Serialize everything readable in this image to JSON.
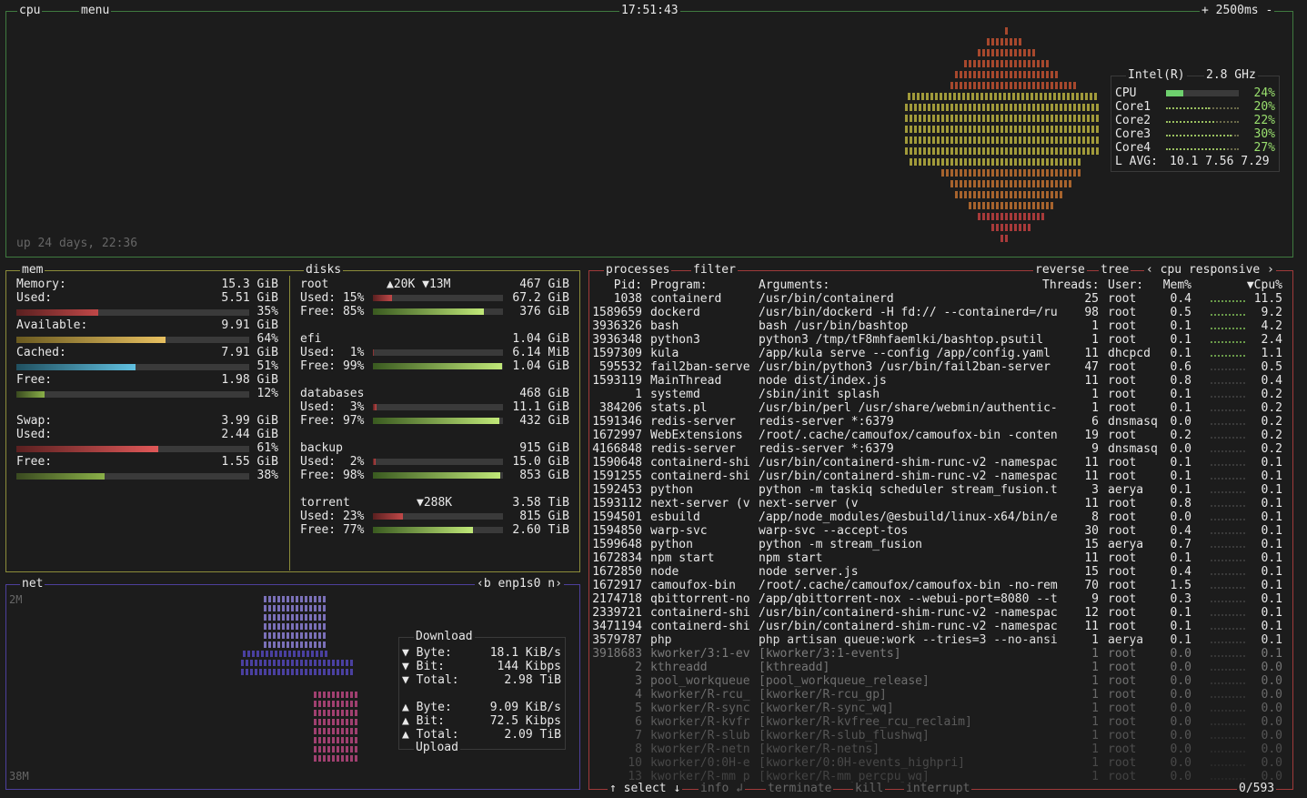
{
  "cpu": {
    "title": "cpu",
    "menu": "menu",
    "clock": "17:51:43",
    "interval": "+ 2500ms -",
    "uptime": "up 24 days, 22:36",
    "model": "Intel(R)",
    "freq": "2.8 GHz",
    "rows": [
      {
        "name": "CPU",
        "pct": "24%",
        "value": 0.24
      },
      {
        "name": "Core1",
        "pct": "20%",
        "value": 0.2
      },
      {
        "name": "Core2",
        "pct": "22%",
        "value": 0.22
      },
      {
        "name": "Core3",
        "pct": "30%",
        "value": 0.3
      },
      {
        "name": "Core4",
        "pct": "27%",
        "value": 0.27
      }
    ],
    "load_label": "L AVG:",
    "load": "10.1 7.56 7.29"
  },
  "mem": {
    "title": "mem",
    "memory_label": "Memory:",
    "memory_total": "15.3 GiB",
    "used_label": "Used:",
    "used_val": "5.51 GiB",
    "used_pct": "35%",
    "used_frac": 0.35,
    "avail_label": "Available:",
    "avail_val": "9.91 GiB",
    "avail_pct": "64%",
    "avail_frac": 0.64,
    "cached_label": "Cached:",
    "cached_val": "7.91 GiB",
    "cached_pct": "51%",
    "cached_frac": 0.51,
    "free_label": "Free:",
    "free_val": "1.98 GiB",
    "free_pct": "12%",
    "free_frac": 0.12,
    "swap_label": "Swap:",
    "swap_total": "3.99 GiB",
    "swap_used_label": "Used:",
    "swap_used_val": "2.44 GiB",
    "swap_used_pct": "61%",
    "swap_used_frac": 0.61,
    "swap_free_label": "Free:",
    "swap_free_val": "1.55 GiB",
    "swap_free_pct": "38%",
    "swap_free_frac": 0.38
  },
  "disks": {
    "title": "disks",
    "list": [
      {
        "name": "root",
        "io": "▲20K ▼13M",
        "total": "467 GiB",
        "used_label": "Used: 15%",
        "used": "67.2 GiB",
        "free_label": "Free: 85%",
        "free": "376 GiB",
        "used_frac": 0.15,
        "free_frac": 0.85
      },
      {
        "name": "efi",
        "io": "",
        "total": "1.04 GiB",
        "used_label": "Used:  1%",
        "used": "6.14 MiB",
        "free_label": "Free: 99%",
        "free": "1.04 GiB",
        "used_frac": 0.01,
        "free_frac": 0.99
      },
      {
        "name": "databases",
        "io": "",
        "total": "468 GiB",
        "used_label": "Used:  3%",
        "used": "11.1 GiB",
        "free_label": "Free: 97%",
        "free": "432 GiB",
        "used_frac": 0.03,
        "free_frac": 0.97
      },
      {
        "name": "backup",
        "io": "",
        "total": "915 GiB",
        "used_label": "Used:  2%",
        "used": "15.0 GiB",
        "free_label": "Free: 98%",
        "free": "853 GiB",
        "used_frac": 0.02,
        "free_frac": 0.98
      },
      {
        "name": "torrent",
        "io": "▼288K",
        "total": "3.58 TiB",
        "used_label": "Used: 23%",
        "used": "815 GiB",
        "free_label": "Free: 77%",
        "free": "2.60 TiB",
        "used_frac": 0.23,
        "free_frac": 0.77
      }
    ]
  },
  "net": {
    "title": "net",
    "iface": "‹b enp1s0 n›",
    "scale_top": "2M",
    "scale_bottom": "38M",
    "download_label": "Download",
    "upload_label": "Upload",
    "down": [
      {
        "label": "▼ Byte:",
        "value": "18.1 KiB/s"
      },
      {
        "label": "▼ Bit:",
        "value": "144 Kibps"
      },
      {
        "label": "▼ Total:",
        "value": "2.98 TiB"
      }
    ],
    "up": [
      {
        "label": "▲ Byte:",
        "value": "9.09 KiB/s"
      },
      {
        "label": "▲ Bit:",
        "value": "72.5 Kibps"
      },
      {
        "label": "▲ Total:",
        "value": "2.09 TiB"
      }
    ]
  },
  "proc": {
    "title": "processes",
    "filter": "filter",
    "reverse": "reverse",
    "tree": "tree",
    "sort": "‹ cpu responsive ›",
    "headers": {
      "pid": "Pid:",
      "program": "Program:",
      "args": "Arguments:",
      "threads": "Threads:",
      "user": "User:",
      "mem": "Mem%",
      "cpu": "▼Cpu%"
    },
    "rows": [
      [
        "1038",
        "containerd",
        "/usr/bin/containerd",
        "25",
        "root",
        "0.4",
        "11.5"
      ],
      [
        "1589659",
        "dockerd",
        "/usr/bin/dockerd -H fd:// --containerd=/ru",
        "98",
        "root",
        "0.5",
        "9.2"
      ],
      [
        "3936326",
        "bash",
        "bash /usr/bin/bashtop",
        "1",
        "root",
        "0.1",
        "4.2"
      ],
      [
        "3936348",
        "python3",
        "python3 /tmp/tF8mhfaemlki/bashtop.psutil",
        "1",
        "root",
        "0.1",
        "2.4"
      ],
      [
        "1597309",
        "kula",
        "/app/kula serve --config /app/config.yaml",
        "11",
        "dhcpcd",
        "0.1",
        "1.1"
      ],
      [
        "595532",
        "fail2ban-serve",
        "/usr/bin/python3 /usr/bin/fail2ban-server",
        "47",
        "root",
        "0.6",
        "0.5"
      ],
      [
        "1593119",
        "MainThread",
        "node dist/index.js",
        "11",
        "root",
        "0.8",
        "0.4"
      ],
      [
        "1",
        "systemd",
        "/sbin/init splash",
        "1",
        "root",
        "0.1",
        "0.2"
      ],
      [
        "384206",
        "stats.pl",
        "/usr/bin/perl /usr/share/webmin/authentic-",
        "1",
        "root",
        "0.1",
        "0.2"
      ],
      [
        "1591346",
        "redis-server",
        "redis-server *:6379",
        "6",
        "dnsmasq",
        "0.0",
        "0.2"
      ],
      [
        "1672997",
        "WebExtensions",
        "/root/.cache/camoufox/camoufox-bin -conten",
        "19",
        "root",
        "0.2",
        "0.2"
      ],
      [
        "4166848",
        "redis-server",
        "redis-server *:6379",
        "9",
        "dnsmasq",
        "0.0",
        "0.2"
      ],
      [
        "1590648",
        "containerd-shi",
        "/usr/bin/containerd-shim-runc-v2 -namespac",
        "11",
        "root",
        "0.1",
        "0.1"
      ],
      [
        "1591255",
        "containerd-shi",
        "/usr/bin/containerd-shim-runc-v2 -namespac",
        "11",
        "root",
        "0.1",
        "0.1"
      ],
      [
        "1592453",
        "python",
        "python -m taskiq scheduler stream_fusion.t",
        "3",
        "aerya",
        "0.1",
        "0.1"
      ],
      [
        "1593112",
        "next-server (v",
        "next-server (v",
        "11",
        "root",
        "0.8",
        "0.1"
      ],
      [
        "1594501",
        "esbuild",
        "/app/node_modules/@esbuild/linux-x64/bin/e",
        "8",
        "root",
        "0.0",
        "0.1"
      ],
      [
        "1594850",
        "warp-svc",
        "warp-svc --accept-tos",
        "30",
        "root",
        "0.4",
        "0.1"
      ],
      [
        "1599648",
        "python",
        "python -m stream_fusion",
        "15",
        "aerya",
        "0.7",
        "0.1"
      ],
      [
        "1672834",
        "npm start",
        "npm start",
        "11",
        "root",
        "0.1",
        "0.1"
      ],
      [
        "1672850",
        "node",
        "node server.js",
        "15",
        "root",
        "0.4",
        "0.1"
      ],
      [
        "1672917",
        "camoufox-bin",
        "/root/.cache/camoufox/camoufox-bin -no-rem",
        "70",
        "root",
        "1.5",
        "0.1"
      ],
      [
        "2174718",
        "qbittorrent-no",
        "/app/qbittorrent-nox --webui-port=8080 --t",
        "9",
        "root",
        "0.3",
        "0.1"
      ],
      [
        "2339721",
        "containerd-shi",
        "/usr/bin/containerd-shim-runc-v2 -namespac",
        "12",
        "root",
        "0.1",
        "0.1"
      ],
      [
        "3471194",
        "containerd-shi",
        "/usr/bin/containerd-shim-runc-v2 -namespac",
        "11",
        "root",
        "0.1",
        "0.1"
      ],
      [
        "3579787",
        "php",
        "php artisan queue:work --tries=3 --no-ansi",
        "1",
        "aerya",
        "0.1",
        "0.1"
      ],
      [
        "3918683",
        "kworker/3:1-ev",
        "[kworker/3:1-events]",
        "1",
        "root",
        "0.0",
        "0.1"
      ],
      [
        "2",
        "kthreadd",
        "[kthreadd]",
        "1",
        "root",
        "0.0",
        "0.0"
      ],
      [
        "3",
        "pool_workqueue",
        "[pool_workqueue_release]",
        "1",
        "root",
        "0.0",
        "0.0"
      ],
      [
        "4",
        "kworker/R-rcu_",
        "[kworker/R-rcu_gp]",
        "1",
        "root",
        "0.0",
        "0.0"
      ],
      [
        "5",
        "kworker/R-sync",
        "[kworker/R-sync_wq]",
        "1",
        "root",
        "0.0",
        "0.0"
      ],
      [
        "6",
        "kworker/R-kvfr",
        "[kworker/R-kvfree_rcu_reclaim]",
        "1",
        "root",
        "0.0",
        "0.0"
      ],
      [
        "7",
        "kworker/R-slub",
        "[kworker/R-slub_flushwq]",
        "1",
        "root",
        "0.0",
        "0.0"
      ],
      [
        "8",
        "kworker/R-netn",
        "[kworker/R-netns]",
        "1",
        "root",
        "0.0",
        "0.0"
      ],
      [
        "10",
        "kworker/0:0H-e",
        "[kworker/0:0H-events_highpri]",
        "1",
        "root",
        "0.0",
        "0.0"
      ],
      [
        "13",
        "kworker/R-mm_p",
        "[kworker/R-mm_percpu_wq]",
        "1",
        "root",
        "0.0",
        "0.0"
      ]
    ],
    "footer": {
      "select": "↑ select ↓",
      "info": "info ↲",
      "terminate": "terminate",
      "kill": "kill",
      "interrupt": "interrupt",
      "count": "0/593"
    }
  },
  "colors": {
    "cpu_border": "#3f7a3f",
    "mem_border": "#8c8c3a",
    "net_border": "#4d3f9c",
    "proc_border": "#a03a3a"
  }
}
